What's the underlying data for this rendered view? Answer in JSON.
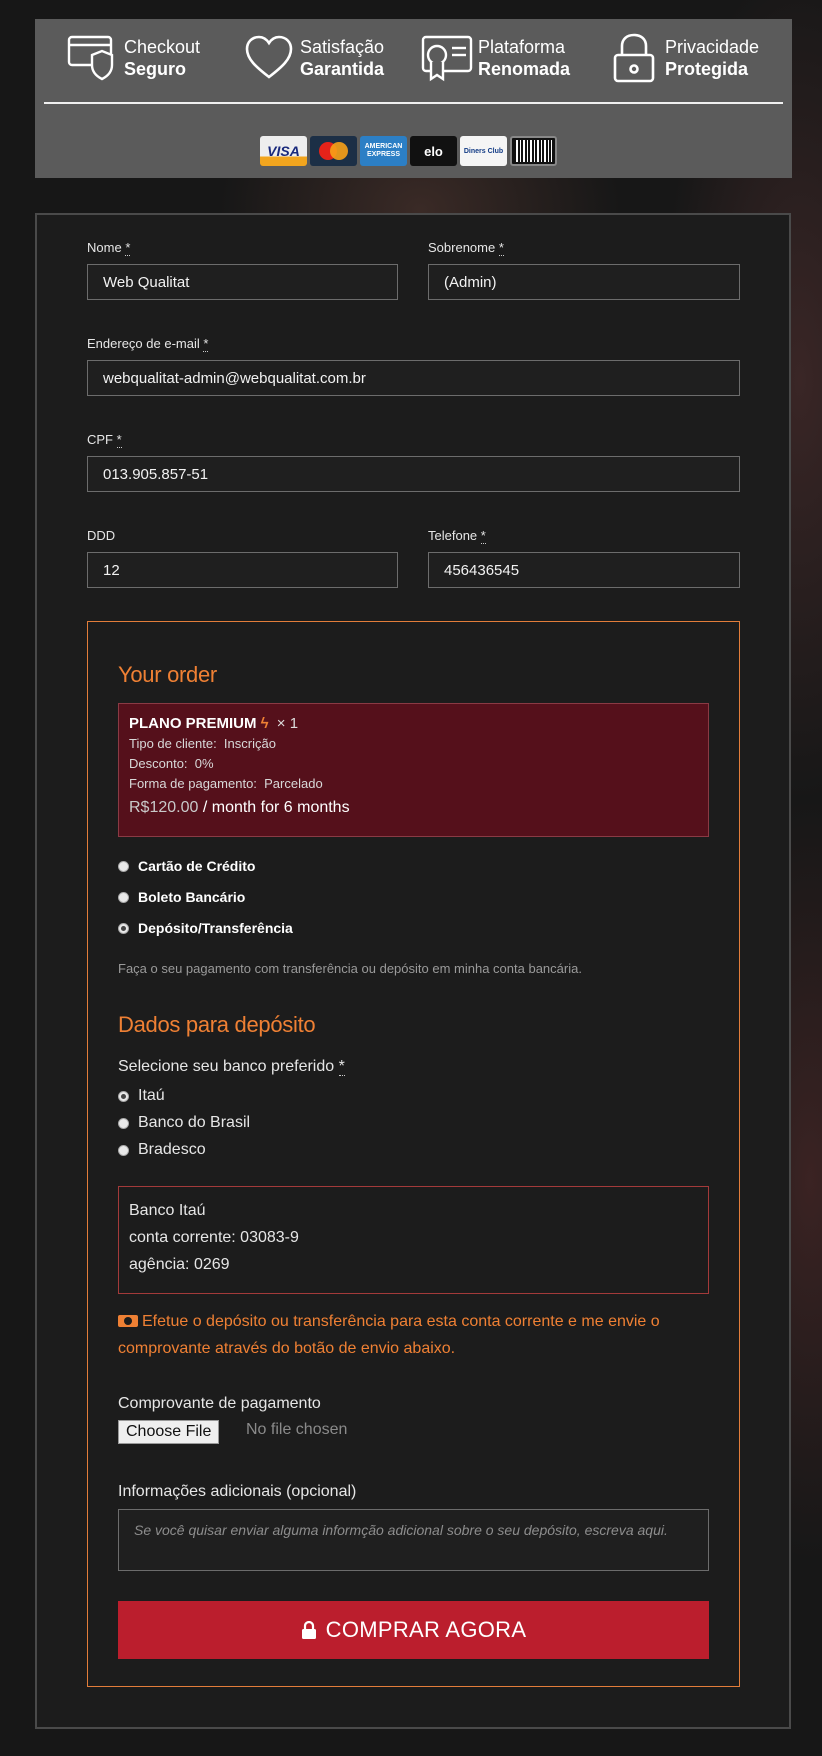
{
  "trust": {
    "badges": [
      {
        "icon": "credit-card-shield-icon",
        "line1": "Checkout",
        "line2": "Seguro"
      },
      {
        "icon": "heart-icon",
        "line1": "Satisfação",
        "line2": "Garantida"
      },
      {
        "icon": "certificate-icon",
        "line1": "Plataforma",
        "line2": "Renomada"
      },
      {
        "icon": "padlock-icon",
        "line1": "Privacidade",
        "line2": "Protegida"
      }
    ],
    "cards": {
      "visa": "VISA",
      "mastercard": "MasterCard",
      "amex_line1": "AMERICAN",
      "amex_line2": "EXPRESS",
      "elo": "elo",
      "diners": "Diners Club"
    }
  },
  "form": {
    "first_name": {
      "label": "Nome",
      "required": "*",
      "value": "Web Qualitat"
    },
    "last_name": {
      "label": "Sobrenome",
      "required": "*",
      "value": "(Admin)"
    },
    "email": {
      "label": "Endereço de e-mail",
      "required": "*",
      "value": "webqualitat-admin@webqualitat.com.br"
    },
    "cpf": {
      "label": "CPF",
      "required": "*",
      "value": "013.905.857-51"
    },
    "ddd": {
      "label": "DDD",
      "value": "12"
    },
    "phone": {
      "label": "Telefone",
      "required": "*",
      "value": "456436545"
    }
  },
  "order": {
    "heading": "Your order",
    "item": {
      "name": "PLANO PREMIUM",
      "qty": "× 1",
      "meta": [
        {
          "key": "Tipo de cliente:",
          "value": "Inscrição"
        },
        {
          "key": "Desconto:",
          "value": "0%"
        },
        {
          "key": "Forma de pagamento:",
          "value": "Parcelado"
        }
      ],
      "price": "R$120.00",
      "price_suffix": "/ month for 6 months"
    },
    "payment_methods": [
      {
        "label": "Cartão de Crédito",
        "selected": false
      },
      {
        "label": "Boleto Bancário",
        "selected": false
      },
      {
        "label": "Depósito/Transferência",
        "selected": true
      }
    ],
    "payment_description": "Faça o seu pagamento com transferência ou depósito em minha conta bancária.",
    "deposit_heading": "Dados para depósito",
    "bank_prompt": "Selecione seu banco preferido",
    "bank_required": "*",
    "banks": [
      {
        "label": "Itaú",
        "selected": true
      },
      {
        "label": "Banco do Brasil",
        "selected": false
      },
      {
        "label": "Bradesco",
        "selected": false
      }
    ],
    "bank_details": {
      "name": "Banco Itaú",
      "account": "conta corrente: 03083-9",
      "agency": "agência: 0269"
    },
    "warning": "Efetue o depósito ou transferência para esta conta corrente e me envie o comprovante através do botão de envio abaixo.",
    "receipt_label": "Comprovante de pagamento",
    "file_button": "Choose File",
    "file_status": "No file chosen",
    "additional_label": "Informações adicionais (opcional)",
    "additional_placeholder": "Se você quisar enviar alguma informção adicional sobre o seu depósito, escreva aqui.",
    "buy_button": "COMPRAR AGORA"
  },
  "colors": {
    "accent_orange": "#ef8034",
    "buy_red": "#bb1e2d",
    "item_bg": "#55101b"
  }
}
